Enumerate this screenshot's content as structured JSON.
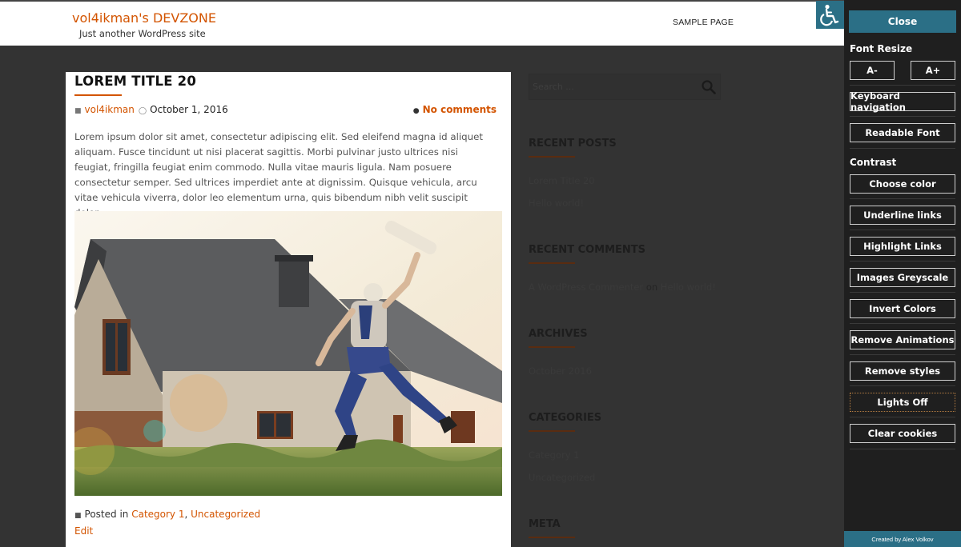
{
  "header": {
    "site_title": "vol4ikman's DEVZONE",
    "site_description": "Just another WordPress site",
    "nav": [
      "SAMPLE PAGE"
    ],
    "accessibility_toggle_icon": "wheelchair-icon"
  },
  "post": {
    "title": "LOREM TITLE 20",
    "author": "vol4ikman",
    "date": "October 1, 2016",
    "comments": "No comments",
    "excerpt": "Lorem ipsum dolor sit amet, consectetur adipiscing elit. Sed eleifend magna id aliquet aliquam. Fusce tincidunt ut nisi placerat sagittis. Morbi pulvinar justo ultrices nisi feugiat, fringilla feugiat enim commodo. Nulla vitae mauris ligula. Nam posuere consectetur semper. Sed ultrices imperdiet ante at dignissim. Quisque vehicula, arcu vitae vehicula viverra, dolor leo elementum urna, quis bibendum nibh velit suscipit dolor.",
    "posted_in_label": "Posted in",
    "categories": [
      "Category 1",
      "Uncategorized"
    ],
    "category_separator": ",",
    "edit_label": "Edit"
  },
  "sidebar": {
    "search_placeholder": "Search ...",
    "recent_posts": {
      "title": "RECENT POSTS",
      "items": [
        "Lorem Title 20",
        "Hello world!"
      ]
    },
    "recent_comments": {
      "title": "RECENT COMMENTS",
      "author": "A WordPress Commenter",
      "on": "on",
      "post": "Hello world!"
    },
    "archives": {
      "title": "ARCHIVES",
      "items": [
        "October 2016"
      ]
    },
    "categories": {
      "title": "CATEGORIES",
      "items": [
        "Category 1",
        "Uncategorized"
      ]
    },
    "meta": {
      "title": "META"
    }
  },
  "a11y_panel": {
    "close": "Close",
    "font_resize_label": "Font Resize",
    "font_decrease": "A-",
    "font_increase": "A+",
    "keyboard_navigation": "Keyboard navigation",
    "readable_font": "Readable Font",
    "contrast_label": "Contrast",
    "choose_color": "Choose color",
    "underline_links": "Underline links",
    "highlight_links": "Highlight Links",
    "images_greyscale": "Images Greyscale",
    "invert_colors": "Invert Colors",
    "remove_animations": "Remove Animations",
    "remove_styles": "Remove styles",
    "lights_off": "Lights Off",
    "clear_cookies": "Clear cookies",
    "footer": "Created by Alex Volkov"
  },
  "colors": {
    "accent": "#d35400",
    "panel_accent": "#2b6f86",
    "page_bg": "#333333",
    "panel_bg": "#1f1f1f"
  }
}
